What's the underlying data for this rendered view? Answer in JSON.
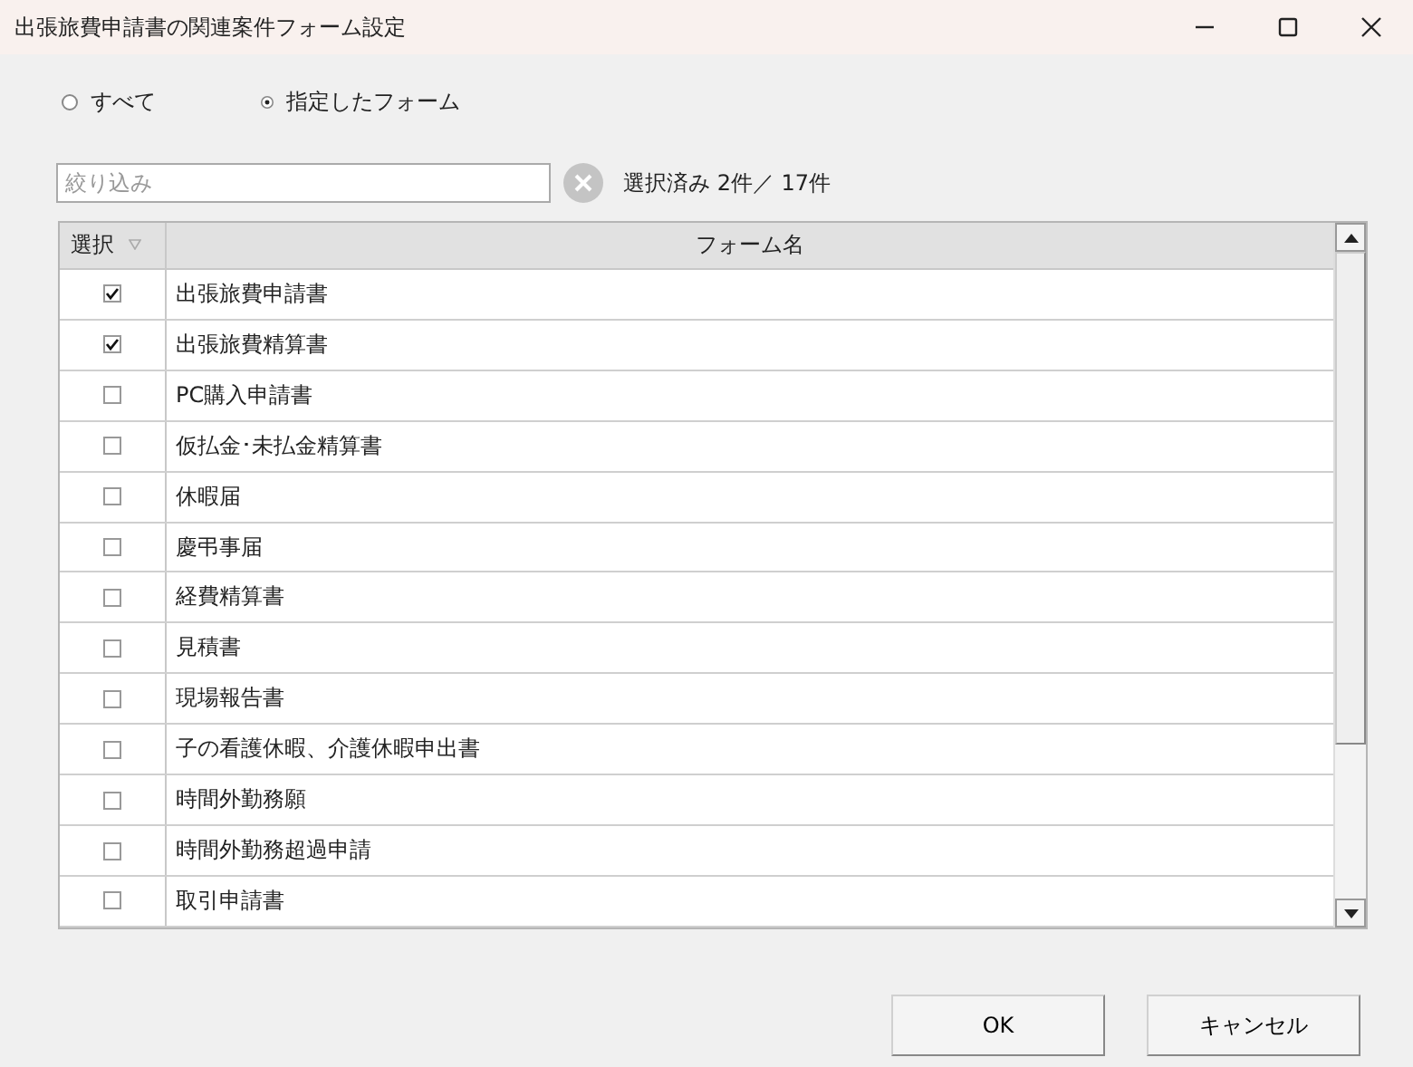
{
  "window": {
    "title": "出張旅費申請書の関連案件フォーム設定"
  },
  "scope_options": [
    {
      "label": "すべて",
      "selected": false
    },
    {
      "label": "指定したフォーム",
      "selected": true
    }
  ],
  "filter": {
    "placeholder": "絞り込み"
  },
  "selection_count": "選択済み 2件／ 17件",
  "table": {
    "columns": [
      "選択",
      "フォーム名"
    ],
    "rows": [
      {
        "checked": true,
        "name": "出張旅費申請書"
      },
      {
        "checked": true,
        "name": "出張旅費精算書"
      },
      {
        "checked": false,
        "name": "PC購入申請書"
      },
      {
        "checked": false,
        "name": "仮払金･未払金精算書"
      },
      {
        "checked": false,
        "name": "休暇届"
      },
      {
        "checked": false,
        "name": "慶弔事届"
      },
      {
        "checked": false,
        "name": "経費精算書"
      },
      {
        "checked": false,
        "name": "見積書"
      },
      {
        "checked": false,
        "name": "現場報告書"
      },
      {
        "checked": false,
        "name": "子の看護休暇、介護休暇申出書"
      },
      {
        "checked": false,
        "name": "時間外勤務願"
      },
      {
        "checked": false,
        "name": "時間外勤務超過申請"
      },
      {
        "checked": false,
        "name": "取引申請書"
      }
    ]
  },
  "buttons": [
    "OK",
    "キャンセル"
  ]
}
